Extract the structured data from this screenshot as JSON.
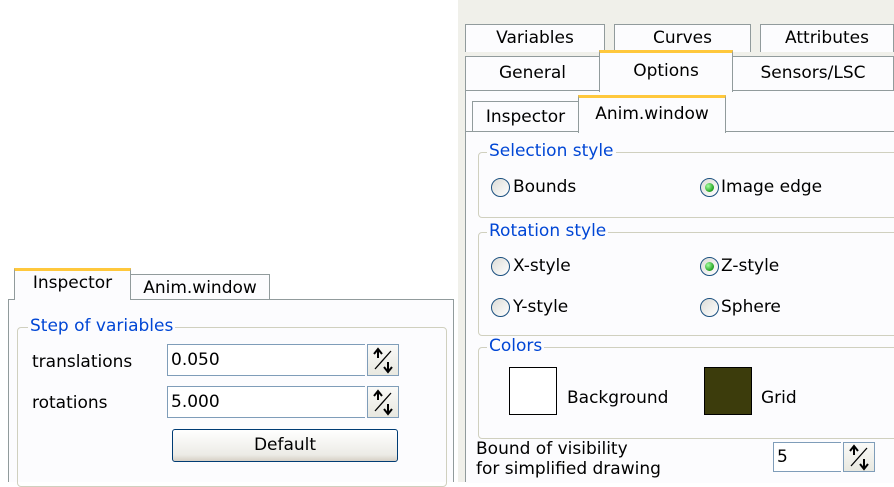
{
  "left_panel": {
    "tabs": [
      "Inspector",
      "Anim.window"
    ],
    "group_title": "Step of variables",
    "rows": [
      {
        "label": "translations",
        "value": "0.050"
      },
      {
        "label": "rotations",
        "value": "5.000"
      }
    ],
    "default_button": "Default"
  },
  "right_panel": {
    "tab_row1": [
      "Variables",
      "Curves",
      "Attributes"
    ],
    "tab_row2": [
      "General",
      "Options",
      "Sensors/LSC"
    ],
    "subtabs": [
      "Inspector",
      "Anim.window"
    ],
    "selection_style": {
      "title": "Selection style",
      "options": [
        {
          "label": "Bounds",
          "selected": false
        },
        {
          "label": "Image edge",
          "selected": true
        }
      ]
    },
    "rotation_style": {
      "title": "Rotation style",
      "options": [
        {
          "label": "X-style",
          "selected": false
        },
        {
          "label": "Z-style",
          "selected": true
        },
        {
          "label": "Y-style",
          "selected": false
        },
        {
          "label": "Sphere",
          "selected": false
        }
      ]
    },
    "colors": {
      "title": "Colors",
      "background_label": "Background",
      "background_color": "#ffffff",
      "grid_label": "Grid",
      "grid_color": "#3c3c0c"
    },
    "bound_label_line1": "Bound of visibility",
    "bound_label_line2": "for simplified drawing",
    "bound_value": "5"
  }
}
